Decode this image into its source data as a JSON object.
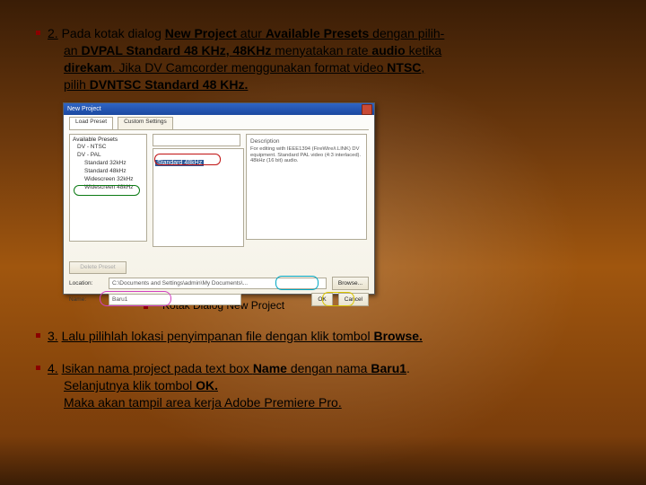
{
  "step2": {
    "num": "2.",
    "l1a": "Pada kotak dialog ",
    "l1b": "New Project",
    "l1c": " atur ",
    "l1d": "Available Presets",
    "l1e": " dengan pilih-",
    "l2a": "an ",
    "l2b": "DVPAL Standard 48 KHz,",
    "l2c": "  48KHz",
    "l2d": " menyatakan rate ",
    "l2e": "audio",
    "l2f": " ketika",
    "l3a": "direkam",
    "l3b": ". Jika DV Camcorder menggunakan format video ",
    "l3c": "NTSC",
    "l3d": ",",
    "l4a": "pilih ",
    "l4b": "DVNTSC Standard 48 KHz."
  },
  "shot": {
    "title": "New Project",
    "tab1": "Load Preset",
    "tab2": "Custom Settings",
    "availHeader": "Available Presets",
    "tree": {
      "i1": "DV - NTSC",
      "i2": "DV - PAL",
      "s1": "Standard 32kHz",
      "s2": "Standard 48kHz",
      "s3": "Widescreen 32kHz",
      "s4": "Widescreen 48kHz"
    },
    "midTopPh": "",
    "midSel": "Standard 48kHz",
    "descHeader": "Description",
    "descBody": "For editing with IEEE1394 (FireWire/i.LINK) DV equipment. Standard PAL video (4:3 interlaced). 48kHz (16 bit) audio.",
    "delPreset": "Delete Preset",
    "locLbl": "Location:",
    "locVal": "C:\\Documents and Settings\\admin\\My Documents\\...",
    "browse": "Browse...",
    "nameLbl": "Name:",
    "nameVal": "Baru1",
    "ok": "OK",
    "cancel": "Cancel"
  },
  "caption": "Kotak Dialog New Project",
  "step3": {
    "num": "3.",
    "t1": "Lalu pilihlah lokasi penyimpanan file dengan klik tombol ",
    "t2": "Browse."
  },
  "step4": {
    "num": "4.",
    "l1a": "Isikan nama project pada text box ",
    "l1b": "Name",
    "l1c": " dengan nama ",
    "l1d": "Baru1",
    "l1e": ".",
    "l2a": "Selanjutnya klik tombol ",
    "l2b": "OK.",
    "l3": "Maka akan tampil area kerja Adobe Premiere Pro."
  }
}
